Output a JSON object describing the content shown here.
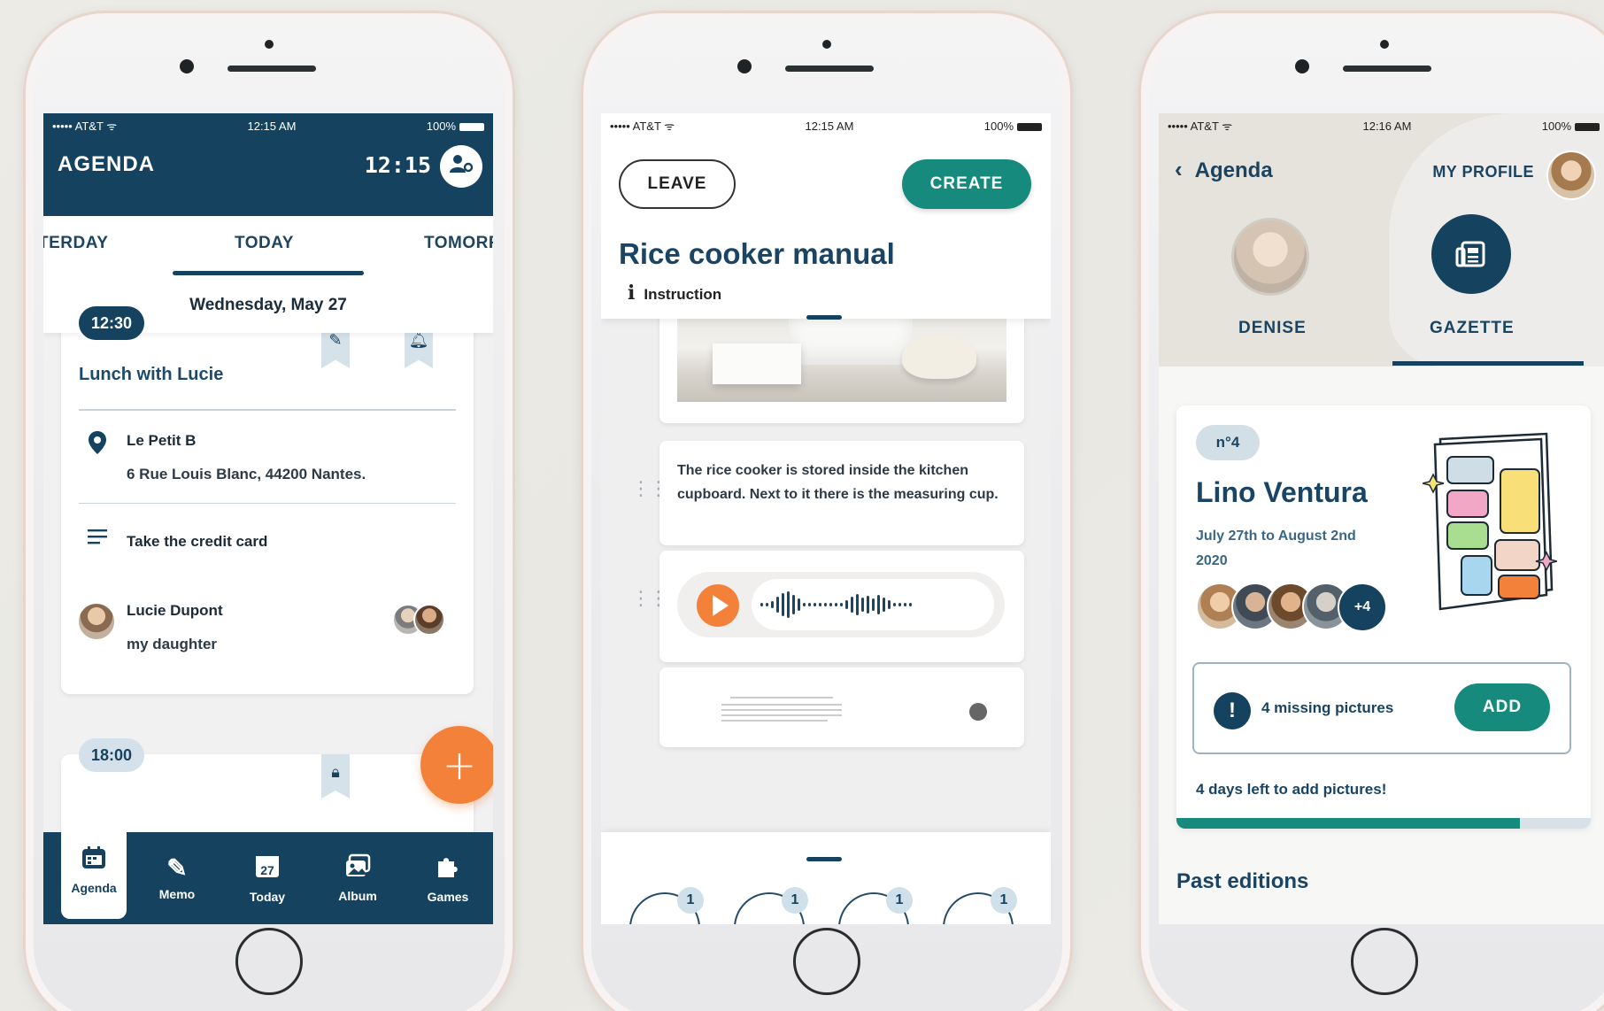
{
  "agenda_screen": {
    "status": {
      "carrier": "••••• AT&T ᯤ",
      "time": "12:15 AM",
      "battery": "100%"
    },
    "title": "AGENDA",
    "clock": "12:15",
    "tabs": {
      "yesterday": "TERDAY",
      "today": "TODAY",
      "tomorrow": "TOMORR"
    },
    "date": "Wednesday, May 27",
    "event1": {
      "time": "12:30",
      "title": "Lunch with Lucie",
      "place_name": "Le Petit B",
      "place_address": "6 Rue Louis Blanc, 44200 Nantes.",
      "note": "Take the credit card",
      "contact_name": "Lucie Dupont",
      "contact_relation": "my daughter"
    },
    "event2": {
      "time": "18:00"
    },
    "fab_label": "+",
    "nav": [
      {
        "label": "Agenda",
        "icon": "calendar-icon"
      },
      {
        "label": "Memo",
        "icon": "edit-icon"
      },
      {
        "label": "Today",
        "icon": "calendar-27-icon",
        "glyph": "27"
      },
      {
        "label": "Album",
        "icon": "album-icon"
      },
      {
        "label": "Games",
        "icon": "puzzle-icon"
      }
    ]
  },
  "editor_screen": {
    "status": {
      "carrier": "••••• AT&T ᯤ",
      "time": "12:15 AM",
      "battery": "100%"
    },
    "leave_label": "LEAVE",
    "create_label": "CREATE",
    "title": "Rice cooker manual",
    "type_label": "Instruction",
    "text_block": "The rice cooker is stored inside the kitchen cupboard. Next to it there is the measuring cup.",
    "tool_badges": [
      "1",
      "1",
      "1",
      "1"
    ]
  },
  "gazette_screen": {
    "status": {
      "carrier": "••••• AT&T ᯤ",
      "time": "12:16 AM",
      "battery": "100%"
    },
    "back_label": "Agenda",
    "profile_label": "MY PROFILE",
    "tabs": {
      "denise": "DENISE",
      "gazette": "GAZETTE"
    },
    "edition_no": "n°4",
    "edition_name": "Lino Ventura",
    "edition_dates": "July 27th to August 2nd 2020",
    "more_contributors": "+4",
    "missing_text": "4 missing pictures",
    "add_label": "ADD",
    "days_left": "4 days left to add pictures!",
    "progress_fraction": 0.83,
    "past_editions": "Past editions"
  },
  "colors": {
    "navy": "#14425f",
    "teal": "#168a7c",
    "orange": "#f4813a",
    "light_blue": "#d4e1ea"
  }
}
